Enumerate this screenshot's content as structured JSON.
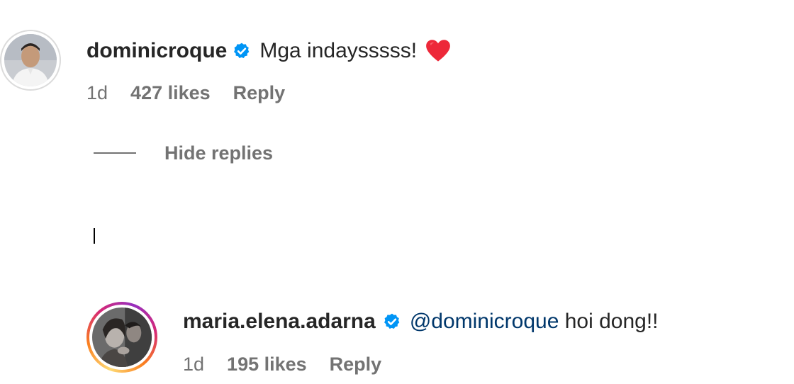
{
  "comments": [
    {
      "username": "dominicroque",
      "verified": true,
      "text": "Mga indaysssss! ",
      "emoji": "heart-emoji",
      "time": "1d",
      "likes": "427 likes",
      "reply": "Reply"
    }
  ],
  "hide_replies": "Hide replies",
  "replies": [
    {
      "username": "maria.elena.adarna",
      "verified": true,
      "mention": "@dominicroque",
      "text": " hoi dong!!",
      "time": "1d",
      "likes": "195 likes",
      "reply": "Reply"
    }
  ],
  "colors": {
    "verified": "#0095f6",
    "heart": "#ed2839",
    "mention": "#00376b",
    "meta": "#737373"
  }
}
